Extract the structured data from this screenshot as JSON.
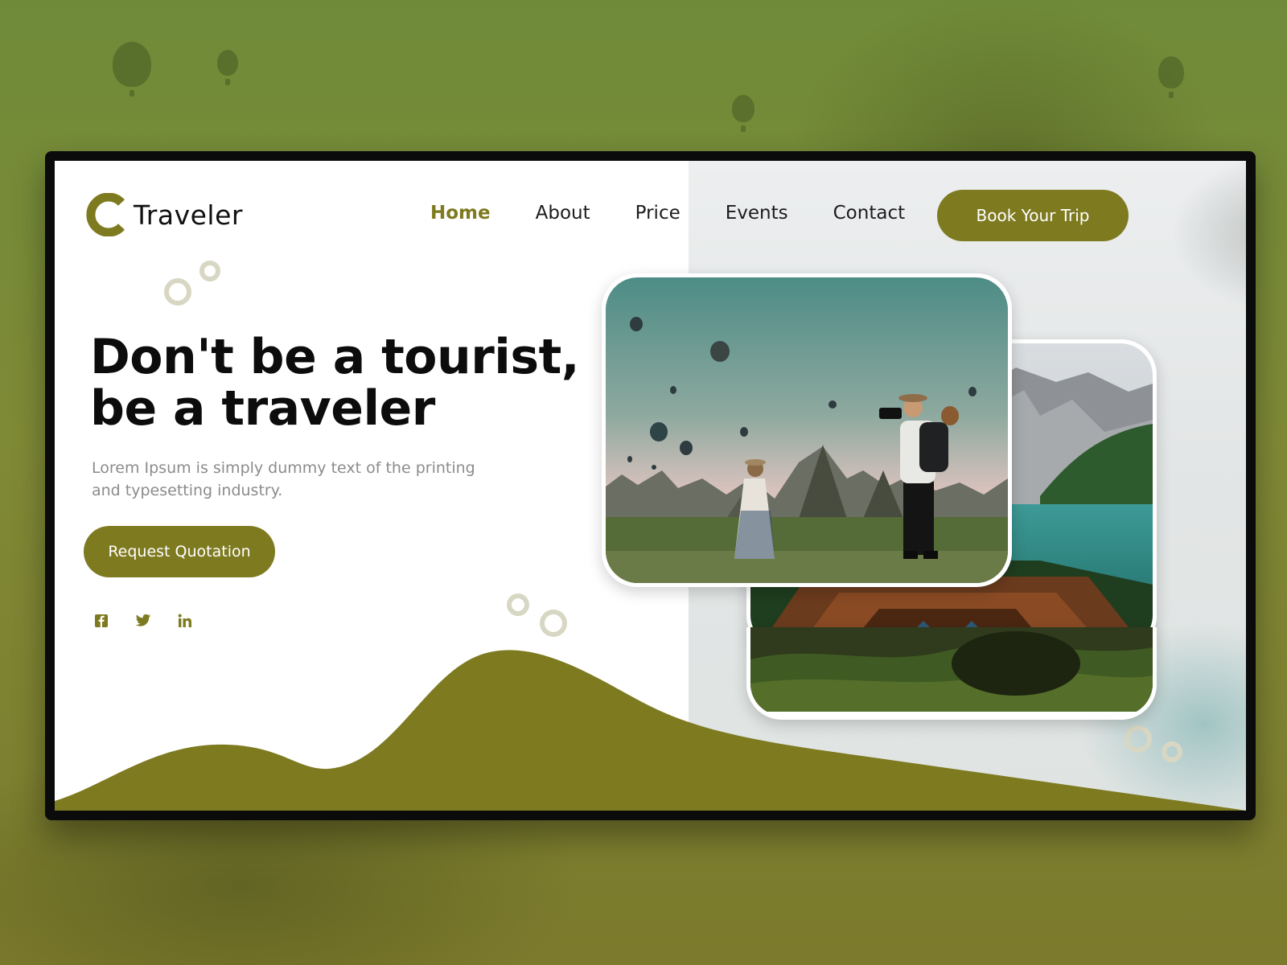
{
  "brand": {
    "name": "Traveler",
    "logo_letter": "C"
  },
  "nav": {
    "items": [
      {
        "label": "Home",
        "active": true
      },
      {
        "label": "About",
        "active": false
      },
      {
        "label": "Price",
        "active": false
      },
      {
        "label": "Events",
        "active": false
      },
      {
        "label": "Contact",
        "active": false
      }
    ],
    "cta_label": "Book Your Trip"
  },
  "hero": {
    "headline_line1": "Don't be a tourist,",
    "headline_line2": "be a traveler",
    "subtext": "Lorem Ipsum is simply dummy text of the printing and typesetting industry.",
    "cta_label": "Request Quotation"
  },
  "social": {
    "icons": [
      "facebook-icon",
      "twitter-icon",
      "linkedin-icon"
    ]
  },
  "images": [
    {
      "name": "hot-air-balloons-photo"
    },
    {
      "name": "mountain-lake-boat-photo"
    },
    {
      "name": "green-valley-photo"
    }
  ],
  "colors": {
    "accent": "#7e7a20",
    "background_tint": "#7a8233",
    "text_dark": "#0c0c0c",
    "text_muted": "#8b8b8b"
  }
}
